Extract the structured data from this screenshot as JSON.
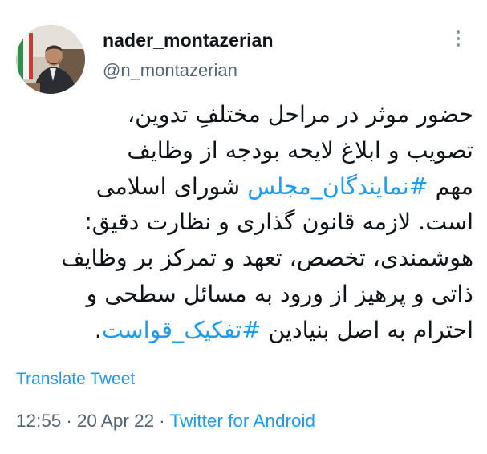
{
  "author": {
    "display_name": "nader_montazerian",
    "handle": "@n_montazerian",
    "avatar": "profile-photo"
  },
  "menu": {
    "icon": "more-vertical-icon"
  },
  "tweet": {
    "lines": [
      [
        {
          "text": "حضور موثر در مراحل مختلفِ تدوین،",
          "hashtag": false
        }
      ],
      [
        {
          "text": "تصویب و ابلاغ لایحه بودجه از وظایف",
          "hashtag": false
        }
      ],
      [
        {
          "text": "مهم ",
          "hashtag": false
        },
        {
          "text": "#نمایندگان_مجلس",
          "hashtag": true
        },
        {
          "text": " شورای اسلامی",
          "hashtag": false
        }
      ],
      [
        {
          "text": "است. لازمه قانون گذاری و نظارت دقیق:",
          "hashtag": false
        }
      ],
      [
        {
          "text": "هوشمندی، تخصص، تعهد و تمرکز بر وظایف",
          "hashtag": false
        }
      ],
      [
        {
          "text": "ذاتی و پرهیز از ورود به مسائل سطحی و",
          "hashtag": false
        }
      ],
      [
        {
          "text": "احترام به اصل بنیادین ",
          "hashtag": false
        },
        {
          "text": "#تفکیک_قواست",
          "hashtag": true
        },
        {
          "text": ".",
          "hashtag": false
        }
      ]
    ]
  },
  "translate_label": "Translate Tweet",
  "meta": {
    "time": "12:55",
    "separator": "·",
    "date": "20 Apr 22",
    "source": "Twitter for Android"
  },
  "colors": {
    "link": "#1d9bf0",
    "secondary_text": "#536471",
    "primary_text": "#0f1419"
  }
}
